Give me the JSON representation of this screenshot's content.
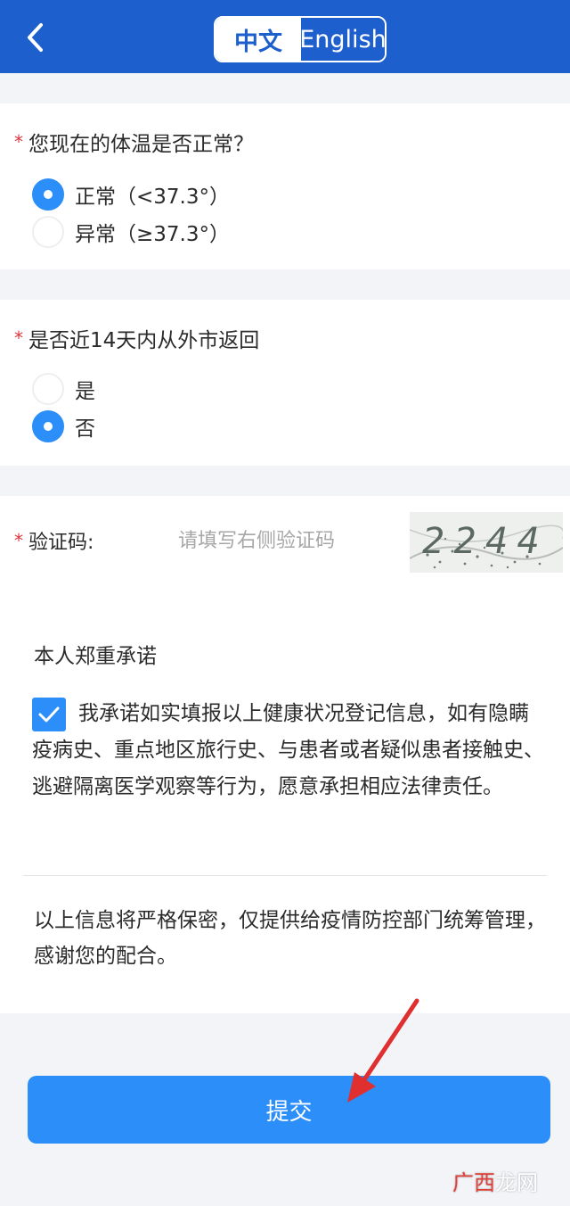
{
  "header": {
    "lang_zh": "中文",
    "lang_en": "English",
    "back_icon": "chevron-left-icon"
  },
  "colors": {
    "header_bg": "#1d5fcc",
    "accent": "#2c8ef8",
    "required": "#d9363e"
  },
  "q1": {
    "required_mark": "*",
    "title": "您现在的体温是否正常？",
    "options": [
      {
        "label": "正常（<37.3°）",
        "selected": true
      },
      {
        "label": "异常（≥37.3°）",
        "selected": false
      }
    ]
  },
  "q2": {
    "required_mark": "*",
    "title": "是否近14天内从外市返回",
    "options": [
      {
        "label": "是",
        "selected": false
      },
      {
        "label": "否",
        "selected": true
      }
    ]
  },
  "captcha": {
    "required_mark": "*",
    "label": "验证码:",
    "placeholder": "请填写右侧验证码",
    "value": "",
    "image_text": "2244"
  },
  "pledge": {
    "title": "本人郑重承诺",
    "checked": true,
    "text": "我承诺如实填报以上健康状况登记信息，如有隐瞒疫病史、重点地区旅行史、与患者或者疑似患者接触史、逃避隔离医学观察等行为，愿意承担相应法律责任。"
  },
  "notice": "以上信息将严格保密，仅提供给疫情防控部门统筹管理，感谢您的配合。",
  "submit_label": "提交",
  "watermark": {
    "accent": "广西",
    "rest": "龙网"
  }
}
